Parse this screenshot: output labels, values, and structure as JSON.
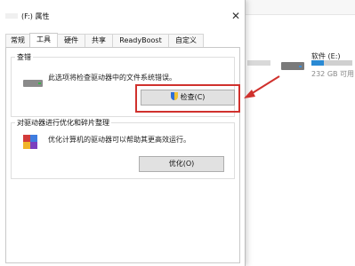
{
  "dialog": {
    "title": "(F:) 属性",
    "close_glyph": "✕",
    "tabs": [
      {
        "label": "常规",
        "active": false
      },
      {
        "label": "工具",
        "active": true
      },
      {
        "label": "硬件",
        "active": false
      },
      {
        "label": "共享",
        "active": false
      },
      {
        "label": "ReadyBoost",
        "active": false
      },
      {
        "label": "自定义",
        "active": false
      }
    ],
    "check_group": {
      "title": "查错",
      "description": "此选项将检查驱动器中的文件系统错误。",
      "button_label": "检查(C)",
      "button_icon": "shield-icon"
    },
    "optimize_group": {
      "title": "对驱动器进行优化和碎片整理",
      "description": "优化计算机的驱动器可以帮助其更高效运行。",
      "button_label": "优化(O)",
      "icon": "defrag-icon"
    }
  },
  "background": {
    "drive_name": "软件 (E:)",
    "drive_size": "232 GB 可用",
    "drive_usage_fraction": 0.3
  },
  "colors": {
    "highlight": "#d0312d",
    "arrow": "#d0312d",
    "usage_bar": "#2a8ad4"
  }
}
